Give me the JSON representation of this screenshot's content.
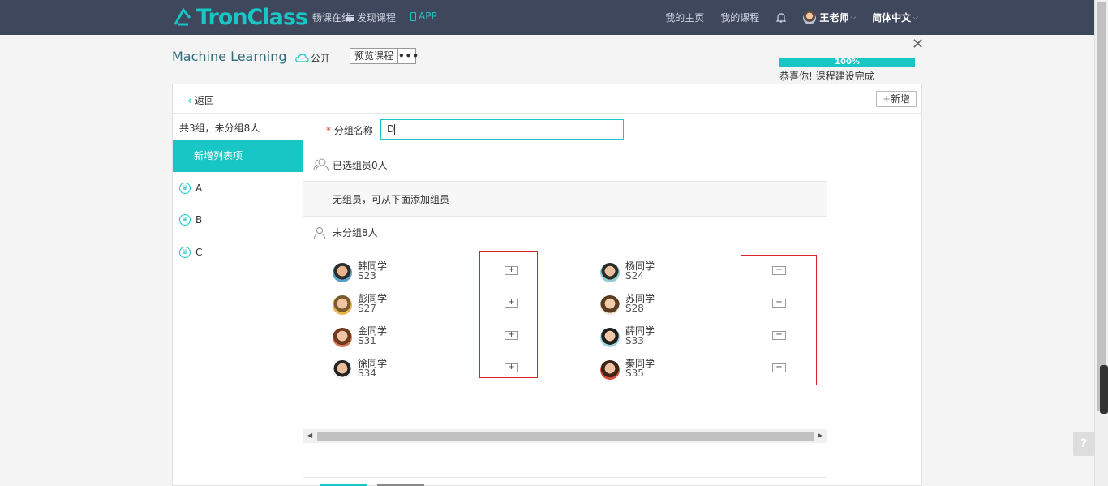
{
  "header": {
    "logo_text": "TronClass",
    "logo_sub": "畅课在线",
    "discover": "发现课程",
    "app": "APP",
    "my_home": "我的主页",
    "my_courses": "我的课程",
    "user_name": "王老师",
    "language": "简体中文"
  },
  "course": {
    "title": "Machine Learning",
    "visibility": "公开",
    "preview_label": "预览课程",
    "more_label": "•••",
    "progress": "100%",
    "congrats": "恭喜你! 课程建设完成"
  },
  "panel": {
    "back_label": "返回",
    "add_label": "新增"
  },
  "sidebar": {
    "summary": "共3组，未分组8人",
    "active_item": "新增列表项",
    "items": [
      {
        "label": "A"
      },
      {
        "label": "B"
      },
      {
        "label": "C"
      }
    ]
  },
  "form": {
    "required_mark": "*",
    "group_name_label": "分组名称",
    "group_name_value": "D",
    "selected_label": "已选组员0人",
    "empty_text": "无组员，可从下面添加组员",
    "ungrouped_label": "未分组8人",
    "add_symbol": "+"
  },
  "students": [
    {
      "name": "韩同学",
      "id": "S23"
    },
    {
      "name": "杨同学",
      "id": "S24"
    },
    {
      "name": "彭同学",
      "id": "S27"
    },
    {
      "name": "苏同学",
      "id": "S28"
    },
    {
      "name": "金同学",
      "id": "S31"
    },
    {
      "name": "薛同学",
      "id": "S33"
    },
    {
      "name": "徐同学",
      "id": "S34"
    },
    {
      "name": "秦同学",
      "id": "S35"
    }
  ],
  "colors": {
    "accent": "#19c6c6",
    "topbar": "#3e475c",
    "highlight": "#d9222a"
  }
}
